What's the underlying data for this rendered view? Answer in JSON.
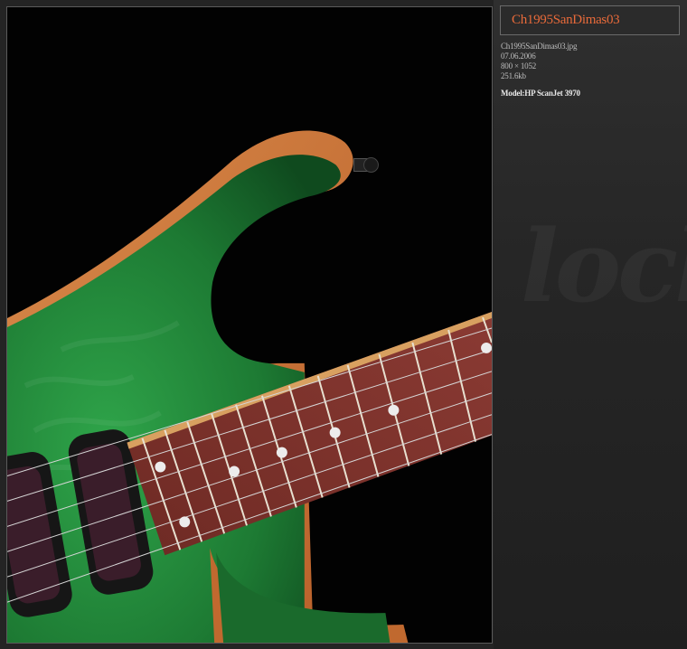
{
  "photo": {
    "subject": "guitar-photo"
  },
  "sidebar": {
    "title": "Ch1995SanDimas03",
    "filename": "Ch1995SanDimas03.jpg",
    "date": "07.06.2006",
    "dimensions": "800 × 1052",
    "filesize": "251.6kb",
    "model": "Model:HP ScanJet 3970"
  },
  "colors": {
    "title": "#e86a3a",
    "background": "#242424"
  }
}
